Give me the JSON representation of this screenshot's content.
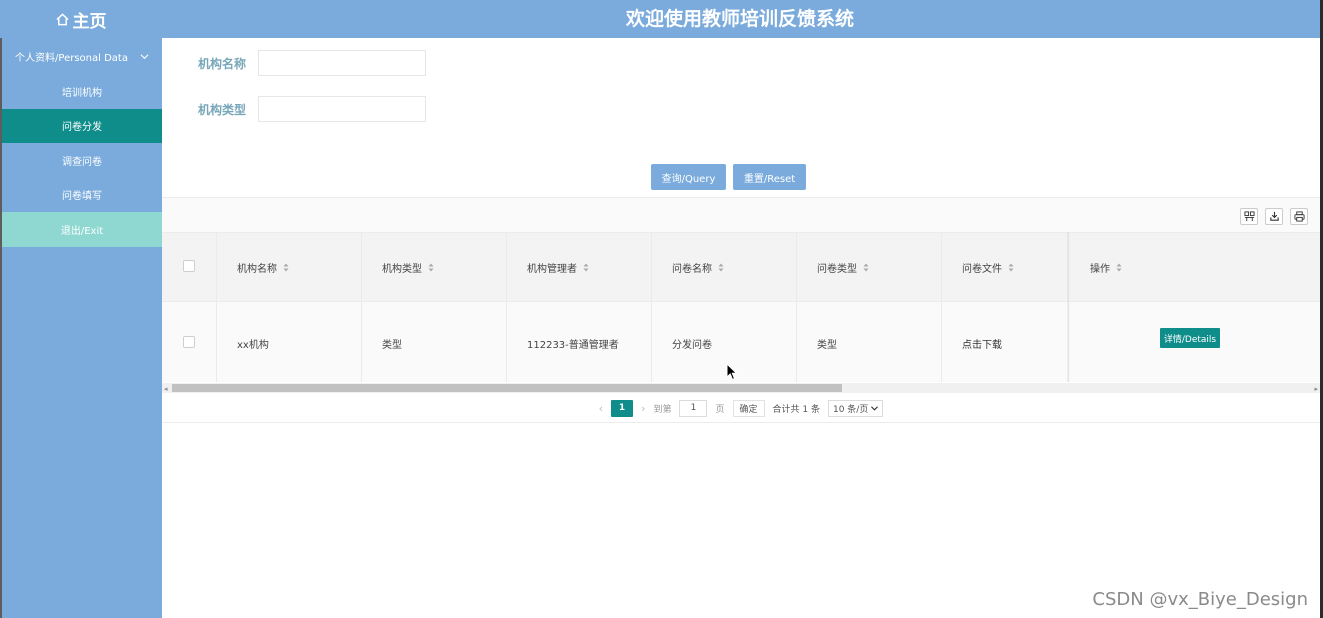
{
  "header": {
    "home_label": "主页",
    "title": "欢迎使用教师培训反馈系统"
  },
  "sidebar": {
    "group_label": "个人资料/Personal Data",
    "items": [
      {
        "label": "培训机构"
      },
      {
        "label": "问卷分发"
      },
      {
        "label": "调查问卷"
      },
      {
        "label": "问卷填写"
      },
      {
        "label": "退出/Exit"
      }
    ]
  },
  "search": {
    "field1_label": "机构名称",
    "field1_value": "",
    "field2_label": "机构类型",
    "field2_value": "",
    "query_button": "查询/Query",
    "reset_button": "重置/Reset"
  },
  "table": {
    "columns": [
      "机构名称",
      "机构类型",
      "机构管理者",
      "问卷名称",
      "问卷类型",
      "问卷文件",
      "操作"
    ],
    "rows": [
      {
        "cells": [
          "xx机构",
          "类型",
          "112233-普通管理者",
          "分发问卷",
          "类型",
          "点击下载"
        ],
        "action": "详情/Details"
      }
    ]
  },
  "pagination": {
    "current_page": "1",
    "goto_prefix": "到第",
    "goto_value": "1",
    "goto_suffix": "页",
    "confirm": "确定",
    "total": "合计共 1 条",
    "page_size": "10 条/页"
  },
  "watermark": "CSDN @vx_Biye_Design",
  "colors": {
    "header_bg": "#7aabdc",
    "active_item": "#0f8d8a",
    "exit_item": "#8fd8d2",
    "label_text": "#78a7b9"
  }
}
